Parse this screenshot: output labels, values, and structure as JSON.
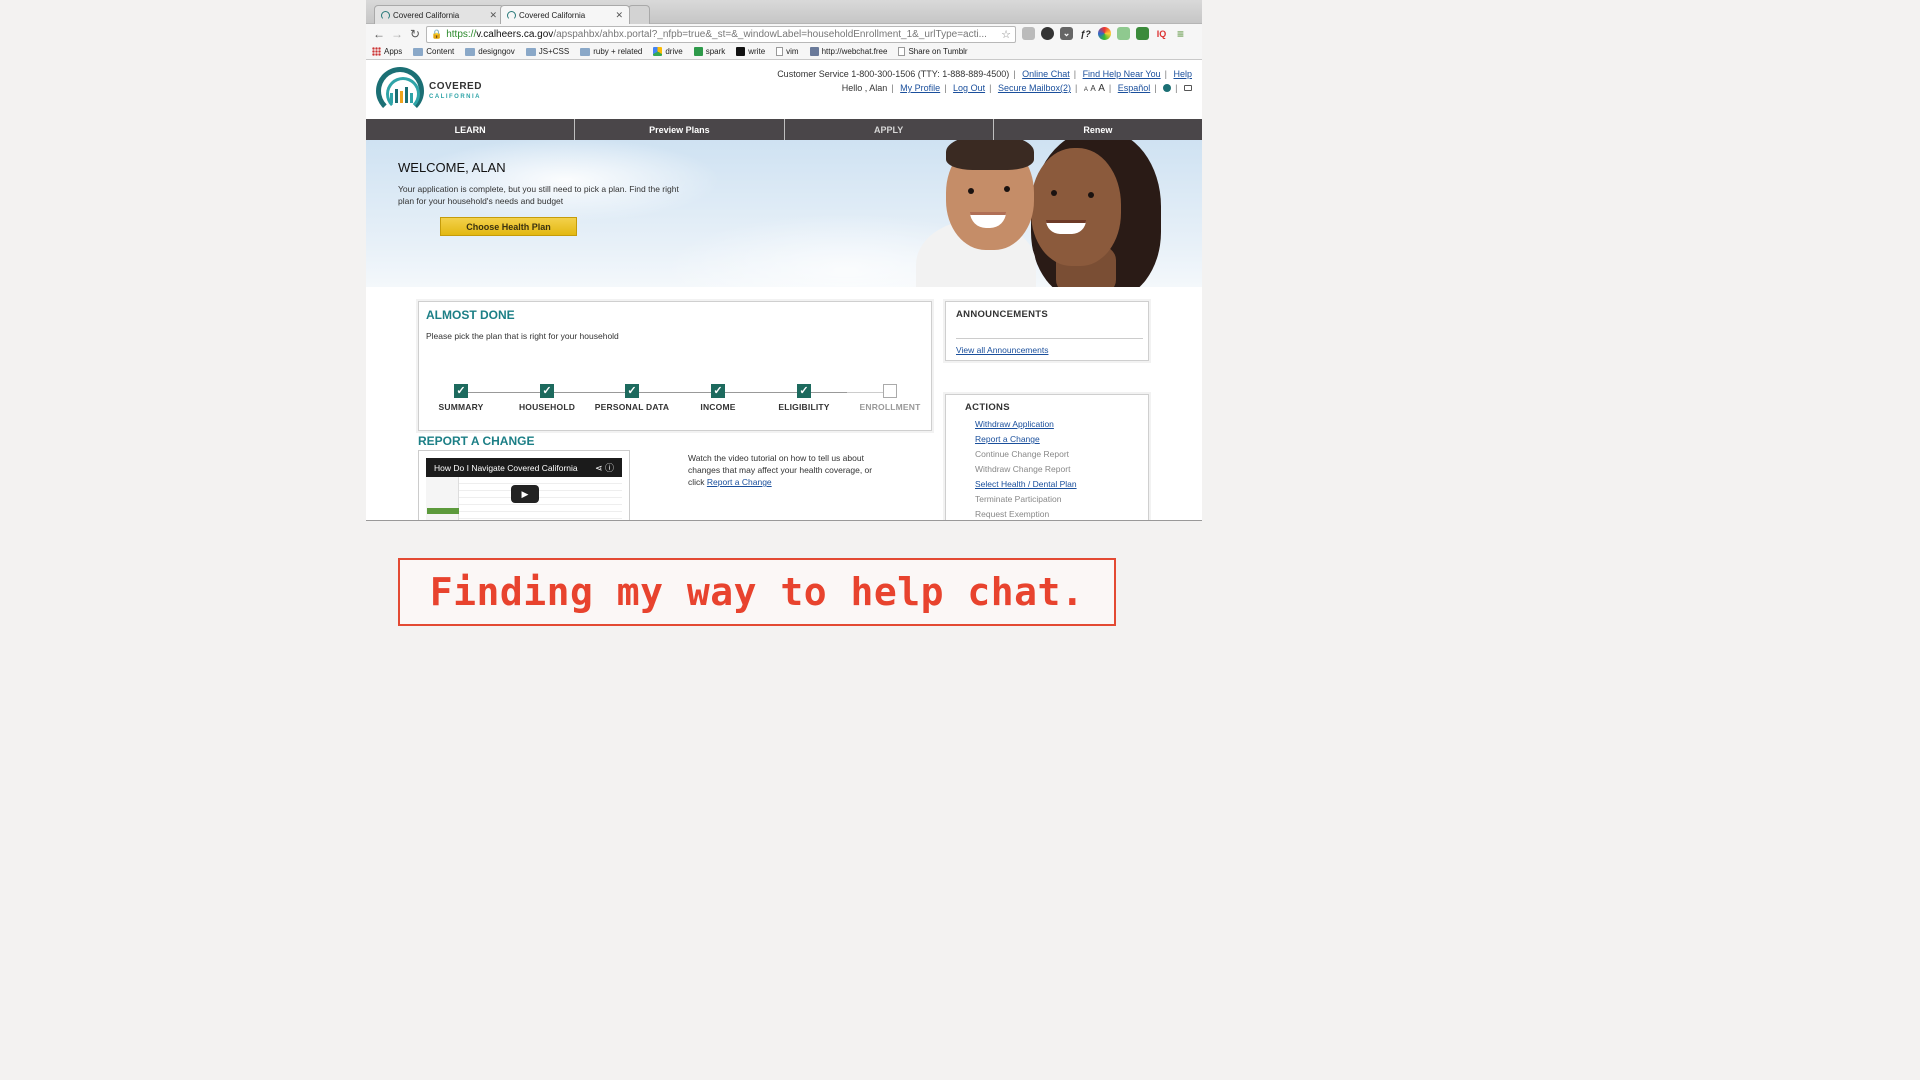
{
  "browser": {
    "tabs": [
      {
        "title": "Covered California",
        "active": false
      },
      {
        "title": "Covered California",
        "active": true
      }
    ],
    "url": {
      "scheme": "https://",
      "host": "v.calheers.ca.gov",
      "path": "/apspahbx/ahbx.portal?_nfpb=true&_st=&_windowLabel=householdEnrollment_1&_urlType=acti..."
    },
    "bookmarks": [
      "Apps",
      "Content",
      "designgov",
      "JS+CSS",
      "ruby + related",
      "drive",
      "spark",
      "write",
      "vim",
      "http://webchat.free",
      "Share on Tumblr"
    ]
  },
  "site": {
    "logo": {
      "line1": "COVERED",
      "line2": "CALIFORNIA"
    },
    "util1": {
      "customer_service": "Customer Service 1-800-300-1506 (TTY: 1-888-889-4500)",
      "online_chat": "Online Chat",
      "find_help": "Find Help Near You",
      "help": "Help"
    },
    "util2": {
      "greeting": "Hello , Alan",
      "my_profile": "My Profile",
      "log_out": "Log Out",
      "secure_mailbox": "Secure Mailbox(2)",
      "text_size": [
        "A",
        "A",
        "A"
      ],
      "espanol": "Español"
    },
    "nav": [
      "LEARN",
      "Preview Plans",
      "APPLY",
      "Renew"
    ],
    "hero": {
      "title": "WELCOME, ALAN",
      "text": "Your application is complete, but you still need to pick a plan. Find the right plan for your household's needs and budget",
      "button": "Choose Health Plan"
    },
    "almost_done": {
      "title": "ALMOST DONE",
      "subtitle": "Please pick the plan that is right for your household",
      "steps": [
        {
          "label": "SUMMARY",
          "done": true
        },
        {
          "label": "HOUSEHOLD",
          "done": true
        },
        {
          "label": "PERSONAL DATA",
          "done": true
        },
        {
          "label": "INCOME",
          "done": true
        },
        {
          "label": "ELIGIBILITY",
          "done": true
        },
        {
          "label": "ENROLLMENT",
          "done": false
        }
      ]
    },
    "announcements": {
      "title": "ANNOUNCEMENTS",
      "link": "View all Announcements"
    },
    "actions": {
      "title": "ACTIONS",
      "items": [
        {
          "label": "Withdraw Application",
          "enabled": true
        },
        {
          "label": "Report a Change",
          "enabled": true
        },
        {
          "label": "Continue Change Report",
          "enabled": false
        },
        {
          "label": "Withdraw Change Report",
          "enabled": false
        },
        {
          "label": "Select Health / Dental Plan",
          "enabled": true
        },
        {
          "label": "Terminate Participation",
          "enabled": false
        },
        {
          "label": "Request Exemption",
          "enabled": false
        }
      ]
    },
    "report_change": {
      "title": "REPORT A CHANGE",
      "video_title": "How Do I Navigate Covered California",
      "text": "Watch the video tutorial on how to tell us about changes that may affect your health coverage, or click",
      "link": "Report a Change"
    }
  },
  "caption": "Finding my way to help chat."
}
